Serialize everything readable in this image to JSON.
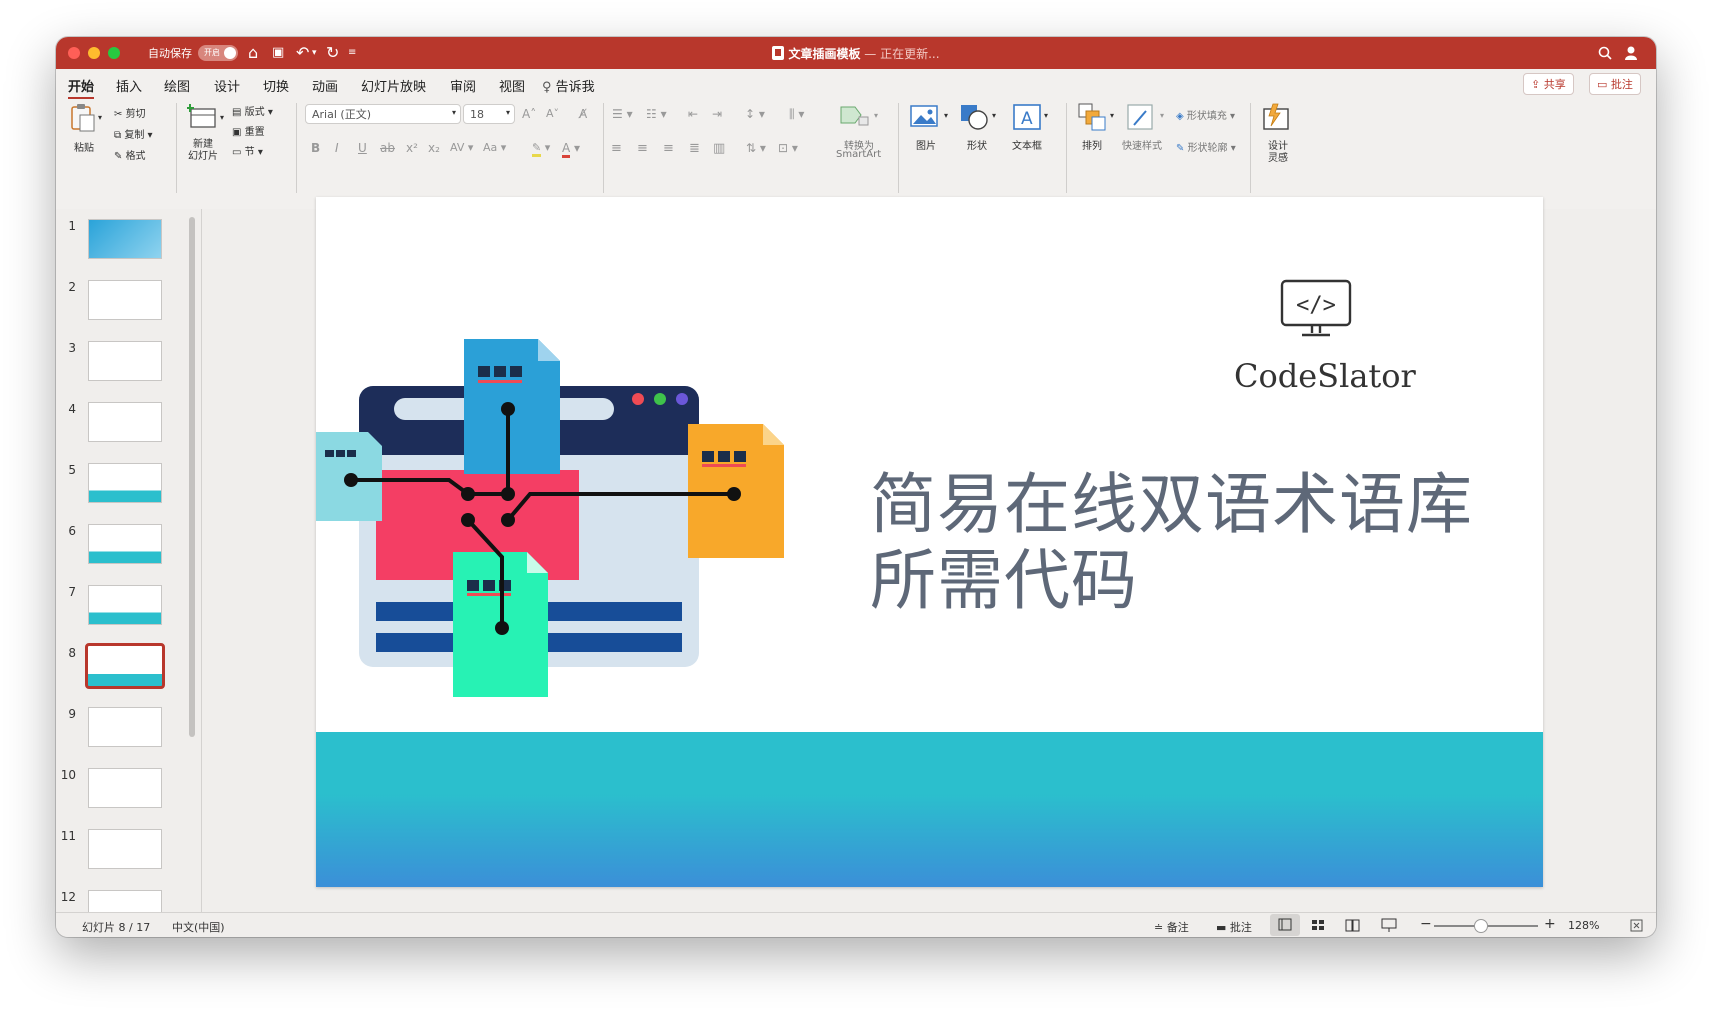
{
  "titlebar": {
    "autosave_label": "自动保存",
    "autosave_state": "开启",
    "document_name": "文章插画模板",
    "document_status": " — 正在更新...",
    "accent_color": "#b8372c"
  },
  "tabs": [
    "开始",
    "插入",
    "绘图",
    "设计",
    "切换",
    "动画",
    "幻灯片放映",
    "审阅",
    "视图",
    "告诉我"
  ],
  "active_tab": "开始",
  "share_label": "共享",
  "comments_label": "批注",
  "ribbon": {
    "paste": "粘贴",
    "cut": "剪切",
    "copy": "复制",
    "format": "格式",
    "new_slide_line1": "新建",
    "new_slide_line2": "幻灯片",
    "layout": "版式",
    "reset": "重置",
    "section": "节",
    "font_name": "Arial (正文)",
    "font_size": "18",
    "convert_line1": "转换为",
    "convert_line2": "SmartArt",
    "picture": "图片",
    "shape": "形状",
    "textbox": "文本框",
    "arrange": "排列",
    "quick_styles": "快速样式",
    "shape_fill": "形状填充",
    "shape_outline": "形状轮廓",
    "designer_line1": "设计",
    "designer_line2": "灵感"
  },
  "slides": {
    "numbers": [
      "1",
      "2",
      "3",
      "4",
      "5",
      "6",
      "7",
      "8",
      "9",
      "10",
      "11",
      "12"
    ],
    "selected": 8
  },
  "slide": {
    "brand": "CodeSlator",
    "brand_icon": "</>",
    "title_line1": "简易在线双语术语库",
    "title_line2": "所需代码"
  },
  "statusbar": {
    "slide_counter": "幻灯片 8 / 17",
    "language": "中文(中国)",
    "notes": "备注",
    "comments": "批注",
    "zoom_minus": "−",
    "zoom_plus": "+",
    "zoom_percent": "128%",
    "zoom_level": 0.45
  }
}
